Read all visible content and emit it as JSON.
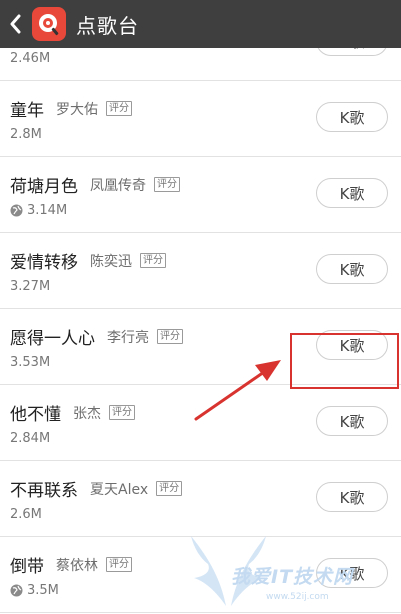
{
  "header": {
    "title": "点歌台",
    "back_icon": "chevron-left-icon",
    "logo_icon": "singing-app-logo-icon"
  },
  "k_button_label": "K歌",
  "rating_tag": "评分",
  "songs": [
    {
      "name": "",
      "artist": "",
      "size": "2.46M",
      "has_globe": false,
      "has_rating": false
    },
    {
      "name": "童年",
      "artist": "罗大佑",
      "size": "2.8M",
      "has_globe": false,
      "has_rating": true
    },
    {
      "name": "荷塘月色",
      "artist": "凤凰传奇",
      "size": "3.14M",
      "has_globe": true,
      "has_rating": true
    },
    {
      "name": "爱情转移",
      "artist": "陈奕迅",
      "size": "3.27M",
      "has_globe": false,
      "has_rating": true
    },
    {
      "name": "愿得一人心",
      "artist": "李行亮",
      "size": "3.53M",
      "has_globe": false,
      "has_rating": true
    },
    {
      "name": "他不懂",
      "artist": "张杰",
      "size": "2.84M",
      "has_globe": false,
      "has_rating": true
    },
    {
      "name": "不再联系",
      "artist": "夏天Alex",
      "size": "2.6M",
      "has_globe": false,
      "has_rating": true
    },
    {
      "name": "倒带",
      "artist": "蔡依林",
      "size": "3.5M",
      "has_globe": true,
      "has_rating": true
    }
  ],
  "annotation": {
    "color": "#d8332f",
    "target_song": "愿得一人心"
  },
  "watermark": {
    "text": "我爱IT技术网",
    "url": "www.52ij.com"
  },
  "colors": {
    "topbar": "#3f3f3f",
    "logo": "#e8483a"
  }
}
